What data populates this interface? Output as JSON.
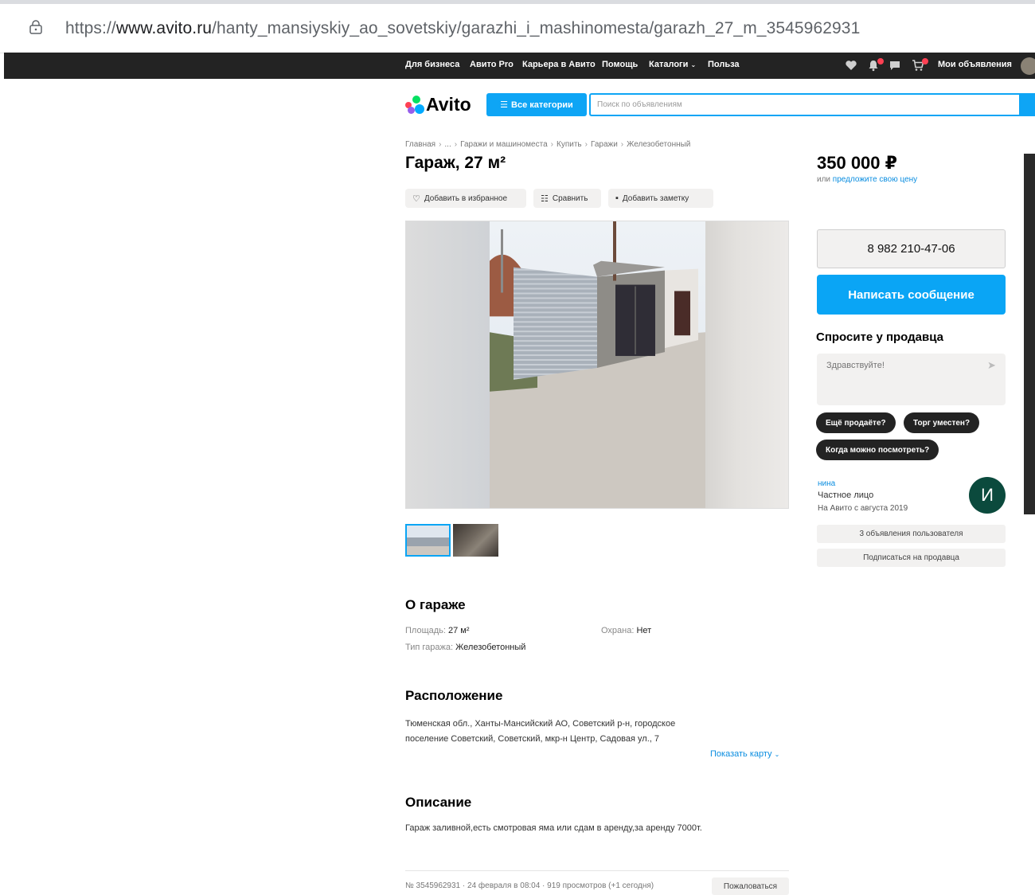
{
  "browser": {
    "url_prefix": "https://",
    "url_domain": "www.avito.ru",
    "url_path": "/hanty_mansiyskiy_ao_sovetskiy/garazhi_i_mashinomesta/garazh_27_m_3545962931"
  },
  "topnav": {
    "links": [
      "Для бизнеса",
      "Авито Pro",
      "Карьера в Авито",
      "Помощь",
      "Каталоги",
      "Польза"
    ],
    "my_ads": "Мои объявления"
  },
  "header": {
    "logo": "Avito",
    "categories_button": "Все категории",
    "search_placeholder": "Поиск по объявлениям"
  },
  "breadcrumb": [
    "Главная",
    "...",
    "Гаражи и машиноместа",
    "Купить",
    "Гаражи",
    "Железобетонный"
  ],
  "listing": {
    "title": "Гараж, 27 м²",
    "actions": {
      "favorite": "Добавить в избранное",
      "compare": "Сравнить",
      "note": "Добавить заметку"
    }
  },
  "sidebar": {
    "price": "350 000 ₽",
    "price_or": "или",
    "price_offer": "предложите свою цену",
    "phone": "8 982 210-47-06",
    "message_button": "Написать сообщение",
    "ask_title": "Спросите у продавца",
    "ask_placeholder": "Здравствуйте!",
    "quick_replies": [
      "Ещё продаёте?",
      "Торг уместен?",
      "Когда можно посмотреть?"
    ],
    "seller": {
      "name": "нина",
      "type": "Частное лицо",
      "since": "На Авито с августа 2019",
      "avatar_letter": "И",
      "ads_button": "3 объявления пользователя",
      "subscribe_button": "Подписаться на продавца"
    }
  },
  "about": {
    "heading": "О гараже",
    "area_label": "Площадь:",
    "area_value": "27 м²",
    "security_label": "Охрана:",
    "security_value": "Нет",
    "type_label": "Тип гаража:",
    "type_value": "Железобетонный"
  },
  "location": {
    "heading": "Расположение",
    "address": "Тюменская обл., Ханты-Мансийский АО, Советский р-н, городское поселение Советский, Советский, мкр-н Центр, Садовая ул., 7",
    "show_map": "Показать карту"
  },
  "description": {
    "heading": "Описание",
    "text": "Гараж заливной,есть смотровая яма или сдам в аренду,за аренду 7000т."
  },
  "footer": {
    "meta": "№ 3545962931 · 24 февраля в 08:04 · 919 просмотров (+1 сегодня)",
    "report_button": "Пожаловаться"
  },
  "colors": {
    "accent": "#0aa5f5",
    "dark": "#232323",
    "link": "#0a8de0"
  }
}
